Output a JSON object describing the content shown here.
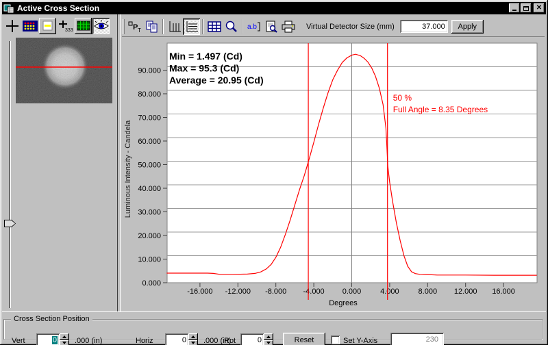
{
  "window": {
    "title": "Active Cross Section"
  },
  "titlebar": {
    "buttons": [
      "minimize",
      "maximize",
      "close"
    ]
  },
  "toolbar_left": {
    "icons": [
      "crosshair-icon",
      "detector-array-icon",
      "image-capture-icon",
      "position-digits-icon",
      "grid-display-icon",
      "live-view-eye-icon"
    ],
    "position_digits": "333"
  },
  "toolbar_right": {
    "icons": [
      "point-table-icon",
      "copy-icon",
      "vertical-profile-icon",
      "horizontal-profile-icon",
      "table-icon",
      "zoom-icon",
      "annotate-icon",
      "print-preview-icon",
      "print-icon"
    ],
    "point_table_text": "P",
    "point_table_sub": "T",
    "annotate_text": "a.b",
    "detector_label": "Virtual Detector Size (mm)",
    "detector_value": "37.000",
    "apply_label": "Apply"
  },
  "chart_data": {
    "type": "line",
    "title": "",
    "xlabel": "Degrees",
    "ylabel": "Luminous Intensity - Candela",
    "xlim": [
      -19.5,
      19.5
    ],
    "ylim": [
      0,
      100
    ],
    "grid": true,
    "x_ticks": [
      -16,
      -12,
      -8,
      -4,
      0,
      4,
      8,
      12,
      16
    ],
    "x_tick_labels": [
      "-16.000",
      "-12.000",
      "-8.000",
      "-4.000",
      "0.000",
      "4.000",
      "8.000",
      "12.000",
      "16.000"
    ],
    "y_ticks": [
      0,
      10,
      20,
      30,
      40,
      50,
      60,
      70,
      80,
      90
    ],
    "y_tick_labels": [
      "0.000",
      "10.000",
      "20.000",
      "30.000",
      "40.000",
      "50.000",
      "60.000",
      "70.000",
      "80.000",
      "90.000"
    ],
    "stats_lines": [
      "Min = 1.497 (Cd)",
      "Max = 95.3 (Cd)",
      "Average = 20.95 (Cd)"
    ],
    "annotation_lines": [
      "50 %",
      "Full Angle = 8.35 Degrees"
    ],
    "cursor_lines_deg": [
      -4.58,
      3.77
    ],
    "series": [
      {
        "name": "luminous-intensity-cross-section",
        "color": "#ff0000",
        "points": [
          [
            -19.5,
            2.6
          ],
          [
            -15.2,
            2.6
          ],
          [
            -14.6,
            2.5
          ],
          [
            -13.9,
            2.1
          ],
          [
            -12.5,
            2.1
          ],
          [
            -11.0,
            2.2
          ],
          [
            -10.2,
            2.5
          ],
          [
            -9.6,
            3.1
          ],
          [
            -9.0,
            4.4
          ],
          [
            -8.5,
            6.3
          ],
          [
            -8.0,
            9.3
          ],
          [
            -7.5,
            13.5
          ],
          [
            -7.0,
            19.0
          ],
          [
            -6.5,
            25.0
          ],
          [
            -6.0,
            31.5
          ],
          [
            -5.5,
            38.0
          ],
          [
            -5.0,
            44.0
          ],
          [
            -4.5,
            50.8
          ],
          [
            -4.0,
            58.0
          ],
          [
            -3.5,
            65.5
          ],
          [
            -3.0,
            72.5
          ],
          [
            -2.5,
            79.0
          ],
          [
            -2.0,
            84.5
          ],
          [
            -1.5,
            88.5
          ],
          [
            -1.0,
            91.8
          ],
          [
            -0.5,
            93.8
          ],
          [
            0.0,
            94.9
          ],
          [
            0.4,
            95.3
          ],
          [
            0.9,
            94.7
          ],
          [
            1.3,
            93.6
          ],
          [
            1.7,
            92.0
          ],
          [
            2.1,
            89.5
          ],
          [
            2.5,
            86.0
          ],
          [
            2.9,
            81.0
          ],
          [
            3.3,
            74.0
          ],
          [
            3.6,
            64.0
          ],
          [
            3.72,
            55.0
          ],
          [
            3.8,
            48.0
          ],
          [
            4.0,
            41.0
          ],
          [
            4.3,
            33.0
          ],
          [
            4.7,
            24.0
          ],
          [
            5.1,
            16.5
          ],
          [
            5.5,
            10.0
          ],
          [
            5.9,
            5.5
          ],
          [
            6.3,
            3.2
          ],
          [
            6.7,
            2.4
          ],
          [
            7.2,
            2.1
          ],
          [
            8.0,
            2.0
          ],
          [
            9.0,
            1.8
          ],
          [
            12.0,
            1.8
          ],
          [
            15.0,
            1.7
          ],
          [
            19.5,
            1.7
          ]
        ]
      }
    ]
  },
  "cross_section_position": {
    "group_title": "Cross Section Position",
    "vert_label": "Vert",
    "vert_value": "0",
    "vert_unit": ".000 (in)",
    "horiz_label": "Horiz",
    "horiz_value": "0",
    "horiz_unit": ".000 (in)",
    "rot_label": "Rot",
    "rot_value": "0",
    "reset_label": "Reset",
    "set_y_axis_label": "Set Y-Axis",
    "set_y_axis_checked": false,
    "y_axis_value": "230"
  },
  "colors": {
    "window_gray": "#c0c0c0",
    "titlebar": "#000000",
    "curve_red": "#ff0000",
    "selection_teal": "#008080",
    "plot_white": "#ffffff",
    "gridline_gray": "#9a9a9a"
  }
}
